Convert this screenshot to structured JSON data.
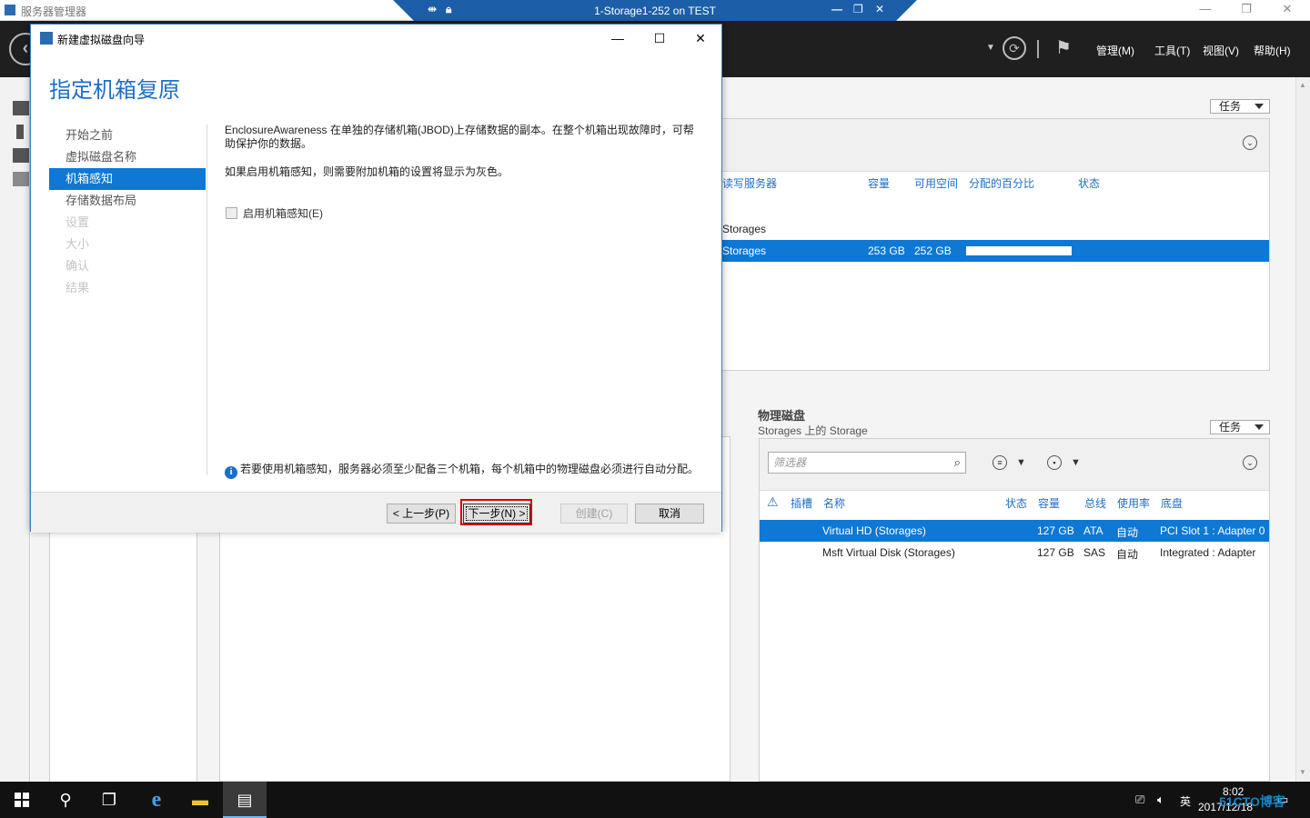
{
  "outer_window": {
    "title": "服务器管理器",
    "rdp_title": "1-Storage1-252 on TEST",
    "menu": [
      "管理(M)",
      "工具(T)",
      "视图(V)",
      "帮助(H)"
    ]
  },
  "upper_panel": {
    "task_label": "任务",
    "columns": [
      "读写服务器",
      "容量",
      "可用空间",
      "分配的百分比",
      "状态"
    ],
    "rows": [
      {
        "name": "Storages"
      },
      {
        "name": "Storages",
        "capacity": "253 GB",
        "free": "252 GB",
        "allocated_percent": 0.0
      }
    ]
  },
  "physical_disks": {
    "title": "物理磁盘",
    "subtitle": "Storages 上的 Storage",
    "task_label": "任务",
    "filter_placeholder": "筛选器",
    "columns": [
      "插槽",
      "名称",
      "状态",
      "容量",
      "总线",
      "使用率",
      "底盘"
    ],
    "rows": [
      {
        "name": "Virtual HD (Storages)",
        "capacity": "127 GB",
        "bus": "ATA",
        "usage": "自动",
        "chassis": "PCI Slot 1 : Adapter 0",
        "selected": true
      },
      {
        "name": "Msft Virtual Disk (Storages)",
        "capacity": "127 GB",
        "bus": "SAS",
        "usage": "自动",
        "chassis": "Integrated : Adapter",
        "selected": false
      }
    ]
  },
  "wizard": {
    "title": "新建虚拟磁盘向导",
    "heading": "指定机箱复原",
    "nav": [
      {
        "label": "开始之前",
        "state": "normal"
      },
      {
        "label": "虚拟磁盘名称",
        "state": "normal"
      },
      {
        "label": "机箱感知",
        "state": "active"
      },
      {
        "label": "存储数据布局",
        "state": "normal"
      },
      {
        "label": "设置",
        "state": "disabled"
      },
      {
        "label": "大小",
        "state": "disabled"
      },
      {
        "label": "确认",
        "state": "disabled"
      },
      {
        "label": "结果",
        "state": "disabled"
      }
    ],
    "paragraph1": "EnclosureAwareness 在单独的存储机箱(JBOD)上存储数据的副本。在整个机箱出现故障时，可帮助保护你的数据。",
    "paragraph2": "如果启用机箱感知，则需要附加机箱的设置将显示为灰色。",
    "checkbox_label": "启用机箱感知(E)",
    "checkbox_checked": false,
    "info_text": "若要使用机箱感知，服务器必须至少配备三个机箱，每个机箱中的物理磁盘必须进行自动分配。",
    "buttons": {
      "prev": "< 上一步(P)",
      "next": "下一步(N) >",
      "create": "创建(C)",
      "cancel": "取消"
    }
  },
  "taskbar": {
    "lang": "英",
    "time": "8:02",
    "date": "2017/12/18"
  },
  "watermark": "51CTO博客"
}
